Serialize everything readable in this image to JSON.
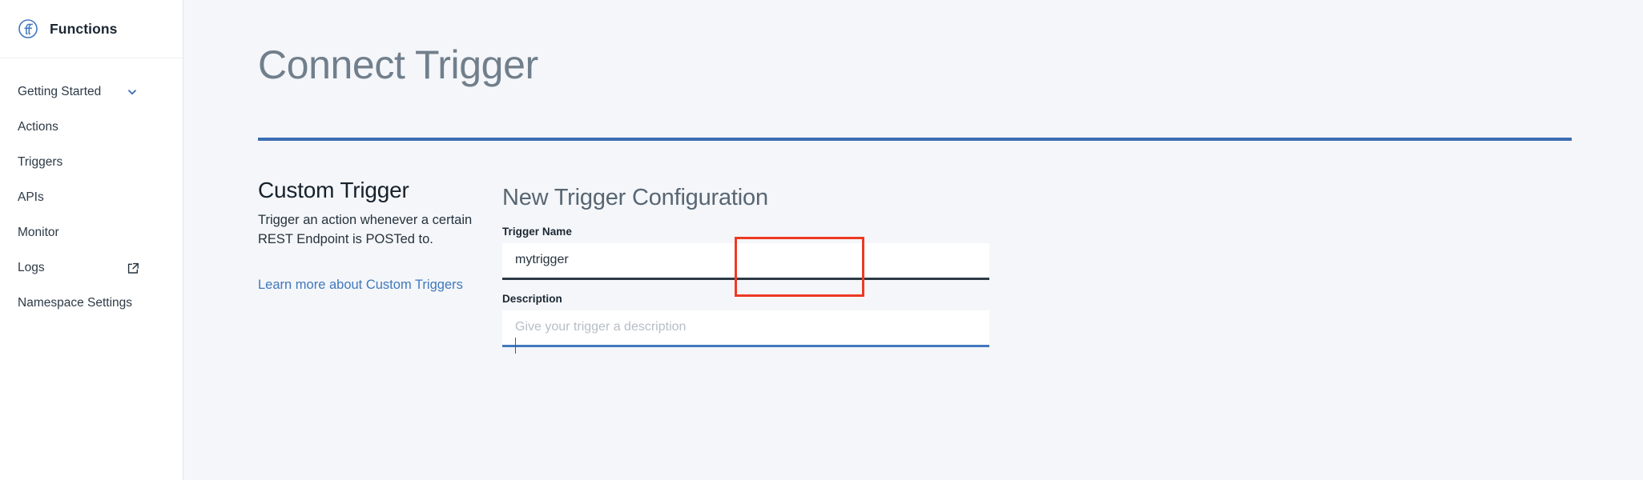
{
  "sidebar": {
    "brand": {
      "logo_icon": "functions-logo-icon",
      "title": "Functions"
    },
    "items": [
      {
        "label": "Getting Started",
        "icon": "chevron-down-icon"
      },
      {
        "label": "Actions",
        "icon": ""
      },
      {
        "label": "Triggers",
        "icon": ""
      },
      {
        "label": "APIs",
        "icon": ""
      },
      {
        "label": "Monitor",
        "icon": ""
      },
      {
        "label": "Logs",
        "icon": "external-link-icon"
      },
      {
        "label": "Namespace Settings",
        "icon": ""
      }
    ]
  },
  "main": {
    "page_title": "Connect Trigger",
    "info": {
      "title": "Custom Trigger",
      "description": "Trigger an action whenever a certain REST Endpoint is POSTed to.",
      "link_label": "Learn more about Custom Triggers"
    },
    "form": {
      "title": "New Trigger Configuration",
      "fields": [
        {
          "label": "Trigger Name",
          "value": "mytrigger",
          "placeholder": "",
          "focused": false
        },
        {
          "label": "Description",
          "value": "",
          "placeholder": "Give your trigger a description",
          "focused": true
        }
      ]
    }
  },
  "colors": {
    "accent_blue": "#4178be",
    "rule_blue": "#3d6cb3",
    "annotation_red": "#ee3a23",
    "sidebar_bg": "#ffffff",
    "content_bg": "#f4f6f9",
    "text_dark": "#1b2733"
  }
}
